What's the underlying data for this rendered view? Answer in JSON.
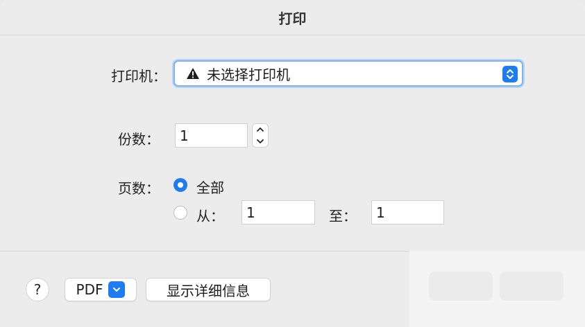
{
  "window": {
    "title": "打印"
  },
  "printer": {
    "label": "打印机：",
    "selected": "未选择打印机",
    "warning_icon": "warning-triangle-icon",
    "accent": "#1e7cf2"
  },
  "copies": {
    "label": "份数：",
    "value": "1"
  },
  "pages": {
    "label": "页数：",
    "all_label": "全部",
    "all_selected": true,
    "from_label": "从：",
    "from_value": "1",
    "to_label": "至：",
    "to_value": "1"
  },
  "footer": {
    "help_label": "?",
    "pdf_label": "PDF",
    "details_label": "显示详细信息"
  }
}
